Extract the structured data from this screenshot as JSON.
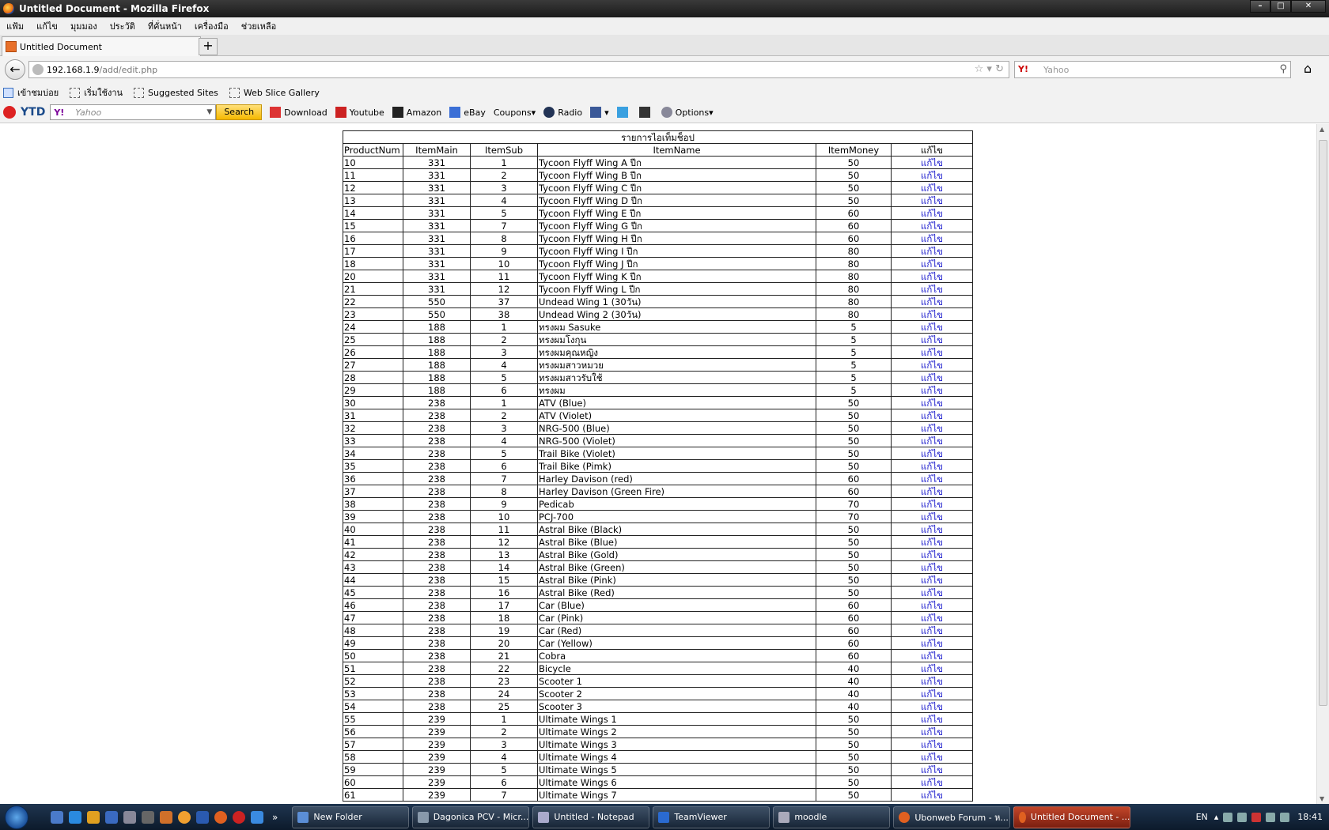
{
  "window": {
    "title": "Untitled Document - Mozilla Firefox"
  },
  "menu": [
    "แฟ้ม",
    "แก้ไข",
    "มุมมอง",
    "ประวัติ",
    "ที่คั่นหน้า",
    "เครื่องมือ",
    "ช่วยเหลือ"
  ],
  "tab": {
    "title": "Untitled Document",
    "new_tab": "+"
  },
  "nav": {
    "url_host": "192.168.1.9",
    "url_path": "/add/edit.php",
    "search_placeholder": "Yahoo",
    "search_engine_logo": "Y!"
  },
  "bookmarks": [
    "เข้าชมบ่อย",
    "เริ่มใช้งาน",
    "Suggested Sites",
    "Web Slice Gallery"
  ],
  "toolbar": {
    "ytd": "YTD",
    "yahoo_logo": "Y!",
    "search_placeholder": "Yahoo",
    "search_button": "Search",
    "items": [
      "Download",
      "Youtube",
      "Amazon",
      "eBay",
      "Coupons",
      "Radio",
      "Options"
    ]
  },
  "table": {
    "caption": "รายการไอเท็มช็อป",
    "headers": [
      "ProductNum",
      "ItemMain",
      "ItemSub",
      "ItemName",
      "ItemMoney",
      "แก้ไข"
    ],
    "edit_label": "แก้ไข",
    "rows": [
      [
        "10",
        "331",
        "1",
        "Tycoon Flyff Wing A ปีก",
        "50"
      ],
      [
        "11",
        "331",
        "2",
        "Tycoon Flyff Wing B ปีก",
        "50"
      ],
      [
        "12",
        "331",
        "3",
        "Tycoon Flyff Wing C ปีก",
        "50"
      ],
      [
        "13",
        "331",
        "4",
        "Tycoon Flyff Wing D ปีก",
        "50"
      ],
      [
        "14",
        "331",
        "5",
        "Tycoon Flyff Wing E ปีก",
        "60"
      ],
      [
        "15",
        "331",
        "7",
        "Tycoon Flyff Wing G ปีก",
        "60"
      ],
      [
        "16",
        "331",
        "8",
        "Tycoon Flyff Wing H ปีก",
        "60"
      ],
      [
        "17",
        "331",
        "9",
        "Tycoon Flyff Wing I ปีก",
        "80"
      ],
      [
        "18",
        "331",
        "10",
        "Tycoon Flyff Wing J ปีก",
        "80"
      ],
      [
        "20",
        "331",
        "11",
        "Tycoon Flyff Wing K ปีก",
        "80"
      ],
      [
        "21",
        "331",
        "12",
        "Tycoon Flyff Wing L ปีก",
        "80"
      ],
      [
        "22",
        "550",
        "37",
        "Undead Wing 1 (30วัน)",
        "80"
      ],
      [
        "23",
        "550",
        "38",
        "Undead Wing 2 (30วัน)",
        "80"
      ],
      [
        "24",
        "188",
        "1",
        "ทรงผม Sasuke",
        "5"
      ],
      [
        "25",
        "188",
        "2",
        "ทรงผมโงกุน",
        "5"
      ],
      [
        "26",
        "188",
        "3",
        "ทรงผมคุณหญิง",
        "5"
      ],
      [
        "27",
        "188",
        "4",
        "ทรงผมสาวหมวย",
        "5"
      ],
      [
        "28",
        "188",
        "5",
        "ทรงผมสาวรับใช้",
        "5"
      ],
      [
        "29",
        "188",
        "6",
        "ทรงผม",
        "5"
      ],
      [
        "30",
        "238",
        "1",
        "ATV (Blue)",
        "50"
      ],
      [
        "31",
        "238",
        "2",
        "ATV (Violet)",
        "50"
      ],
      [
        "32",
        "238",
        "3",
        "NRG-500 (Blue)",
        "50"
      ],
      [
        "33",
        "238",
        "4",
        "NRG-500 (Violet)",
        "50"
      ],
      [
        "34",
        "238",
        "5",
        "Trail Bike (Violet)",
        "50"
      ],
      [
        "35",
        "238",
        "6",
        "Trail Bike (Pimk)",
        "50"
      ],
      [
        "36",
        "238",
        "7",
        "Harley Davison (red)",
        "60"
      ],
      [
        "37",
        "238",
        "8",
        "Harley Davison (Green Fire)",
        "60"
      ],
      [
        "38",
        "238",
        "9",
        "Pedicab",
        "70"
      ],
      [
        "39",
        "238",
        "10",
        "PCJ-700",
        "70"
      ],
      [
        "40",
        "238",
        "11",
        "Astral Bike (Black)",
        "50"
      ],
      [
        "41",
        "238",
        "12",
        "Astral Bike (Blue)",
        "50"
      ],
      [
        "42",
        "238",
        "13",
        "Astral Bike (Gold)",
        "50"
      ],
      [
        "43",
        "238",
        "14",
        "Astral Bike (Green)",
        "50"
      ],
      [
        "44",
        "238",
        "15",
        "Astral Bike (Pink)",
        "50"
      ],
      [
        "45",
        "238",
        "16",
        "Astral Bike (Red)",
        "50"
      ],
      [
        "46",
        "238",
        "17",
        "Car (Blue)",
        "60"
      ],
      [
        "47",
        "238",
        "18",
        "Car (Pink)",
        "60"
      ],
      [
        "48",
        "238",
        "19",
        "Car (Red)",
        "60"
      ],
      [
        "49",
        "238",
        "20",
        "Car (Yellow)",
        "60"
      ],
      [
        "50",
        "238",
        "21",
        "Cobra",
        "60"
      ],
      [
        "51",
        "238",
        "22",
        "Bicycle",
        "40"
      ],
      [
        "52",
        "238",
        "23",
        "Scooter 1",
        "40"
      ],
      [
        "53",
        "238",
        "24",
        "Scooter 2",
        "40"
      ],
      [
        "54",
        "238",
        "25",
        "Scooter 3",
        "40"
      ],
      [
        "55",
        "239",
        "1",
        "Ultimate Wings 1",
        "50"
      ],
      [
        "56",
        "239",
        "2",
        "Ultimate Wings 2",
        "50"
      ],
      [
        "57",
        "239",
        "3",
        "Ultimate Wings 3",
        "50"
      ],
      [
        "58",
        "239",
        "4",
        "Ultimate Wings 4",
        "50"
      ],
      [
        "59",
        "239",
        "5",
        "Ultimate Wings 5",
        "50"
      ],
      [
        "60",
        "239",
        "6",
        "Ultimate Wings 6",
        "50"
      ],
      [
        "61",
        "239",
        "7",
        "Ultimate Wings 7",
        "50"
      ]
    ]
  },
  "taskbar": {
    "tasks": [
      "New Folder",
      "Dagonica PCV - Micr...",
      "Untitled - Notepad",
      "TeamViewer",
      "moodle",
      "Ubonweb Forum - ห...",
      "Untitled Document - ..."
    ],
    "lang": "EN",
    "clock": "18:41"
  },
  "colors": {
    "link": "#1a1acc",
    "taskbar": "#1f3550",
    "search_button": "#f5b800"
  }
}
